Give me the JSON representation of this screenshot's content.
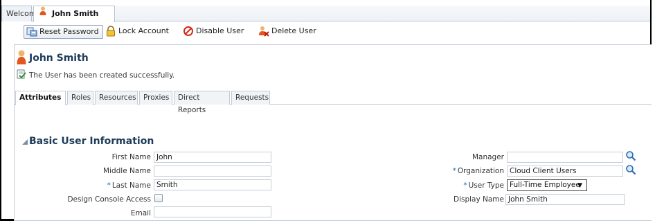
{
  "tabs": {
    "welcome": "Welcome",
    "active": "John Smith"
  },
  "toolbar": {
    "reset_password": "Reset Password",
    "lock_account": "Lock Account",
    "disable_user": "Disable User",
    "delete_user": "Delete User"
  },
  "user": {
    "name": "John Smith",
    "message": "The User has been created successfully."
  },
  "inner_tabs": [
    "Attributes",
    "Roles",
    "Resources",
    "Proxies",
    "Direct Reports",
    "Requests"
  ],
  "section": {
    "title": "Basic User Information"
  },
  "form": {
    "first_name": {
      "label": "First Name",
      "value": "John"
    },
    "middle_name": {
      "label": "Middle Name",
      "value": ""
    },
    "last_name": {
      "label": "Last Name",
      "value": "Smith",
      "required_mark": "*"
    },
    "design_console": {
      "label": "Design Console Access"
    },
    "email": {
      "label": "Email",
      "value": ""
    },
    "manager": {
      "label": "Manager",
      "value": ""
    },
    "organization": {
      "label": "Organization",
      "value": "Cloud Client Users",
      "required_mark": "*"
    },
    "user_type": {
      "label": "User Type",
      "value": "Full-Time Employee",
      "required_mark": "*"
    },
    "display_name": {
      "label": "Display Name",
      "value": "John Smith"
    }
  },
  "colors": {
    "heading": "#1d3b5a",
    "required": "#2a66b8",
    "border": "#c3ccd8"
  }
}
